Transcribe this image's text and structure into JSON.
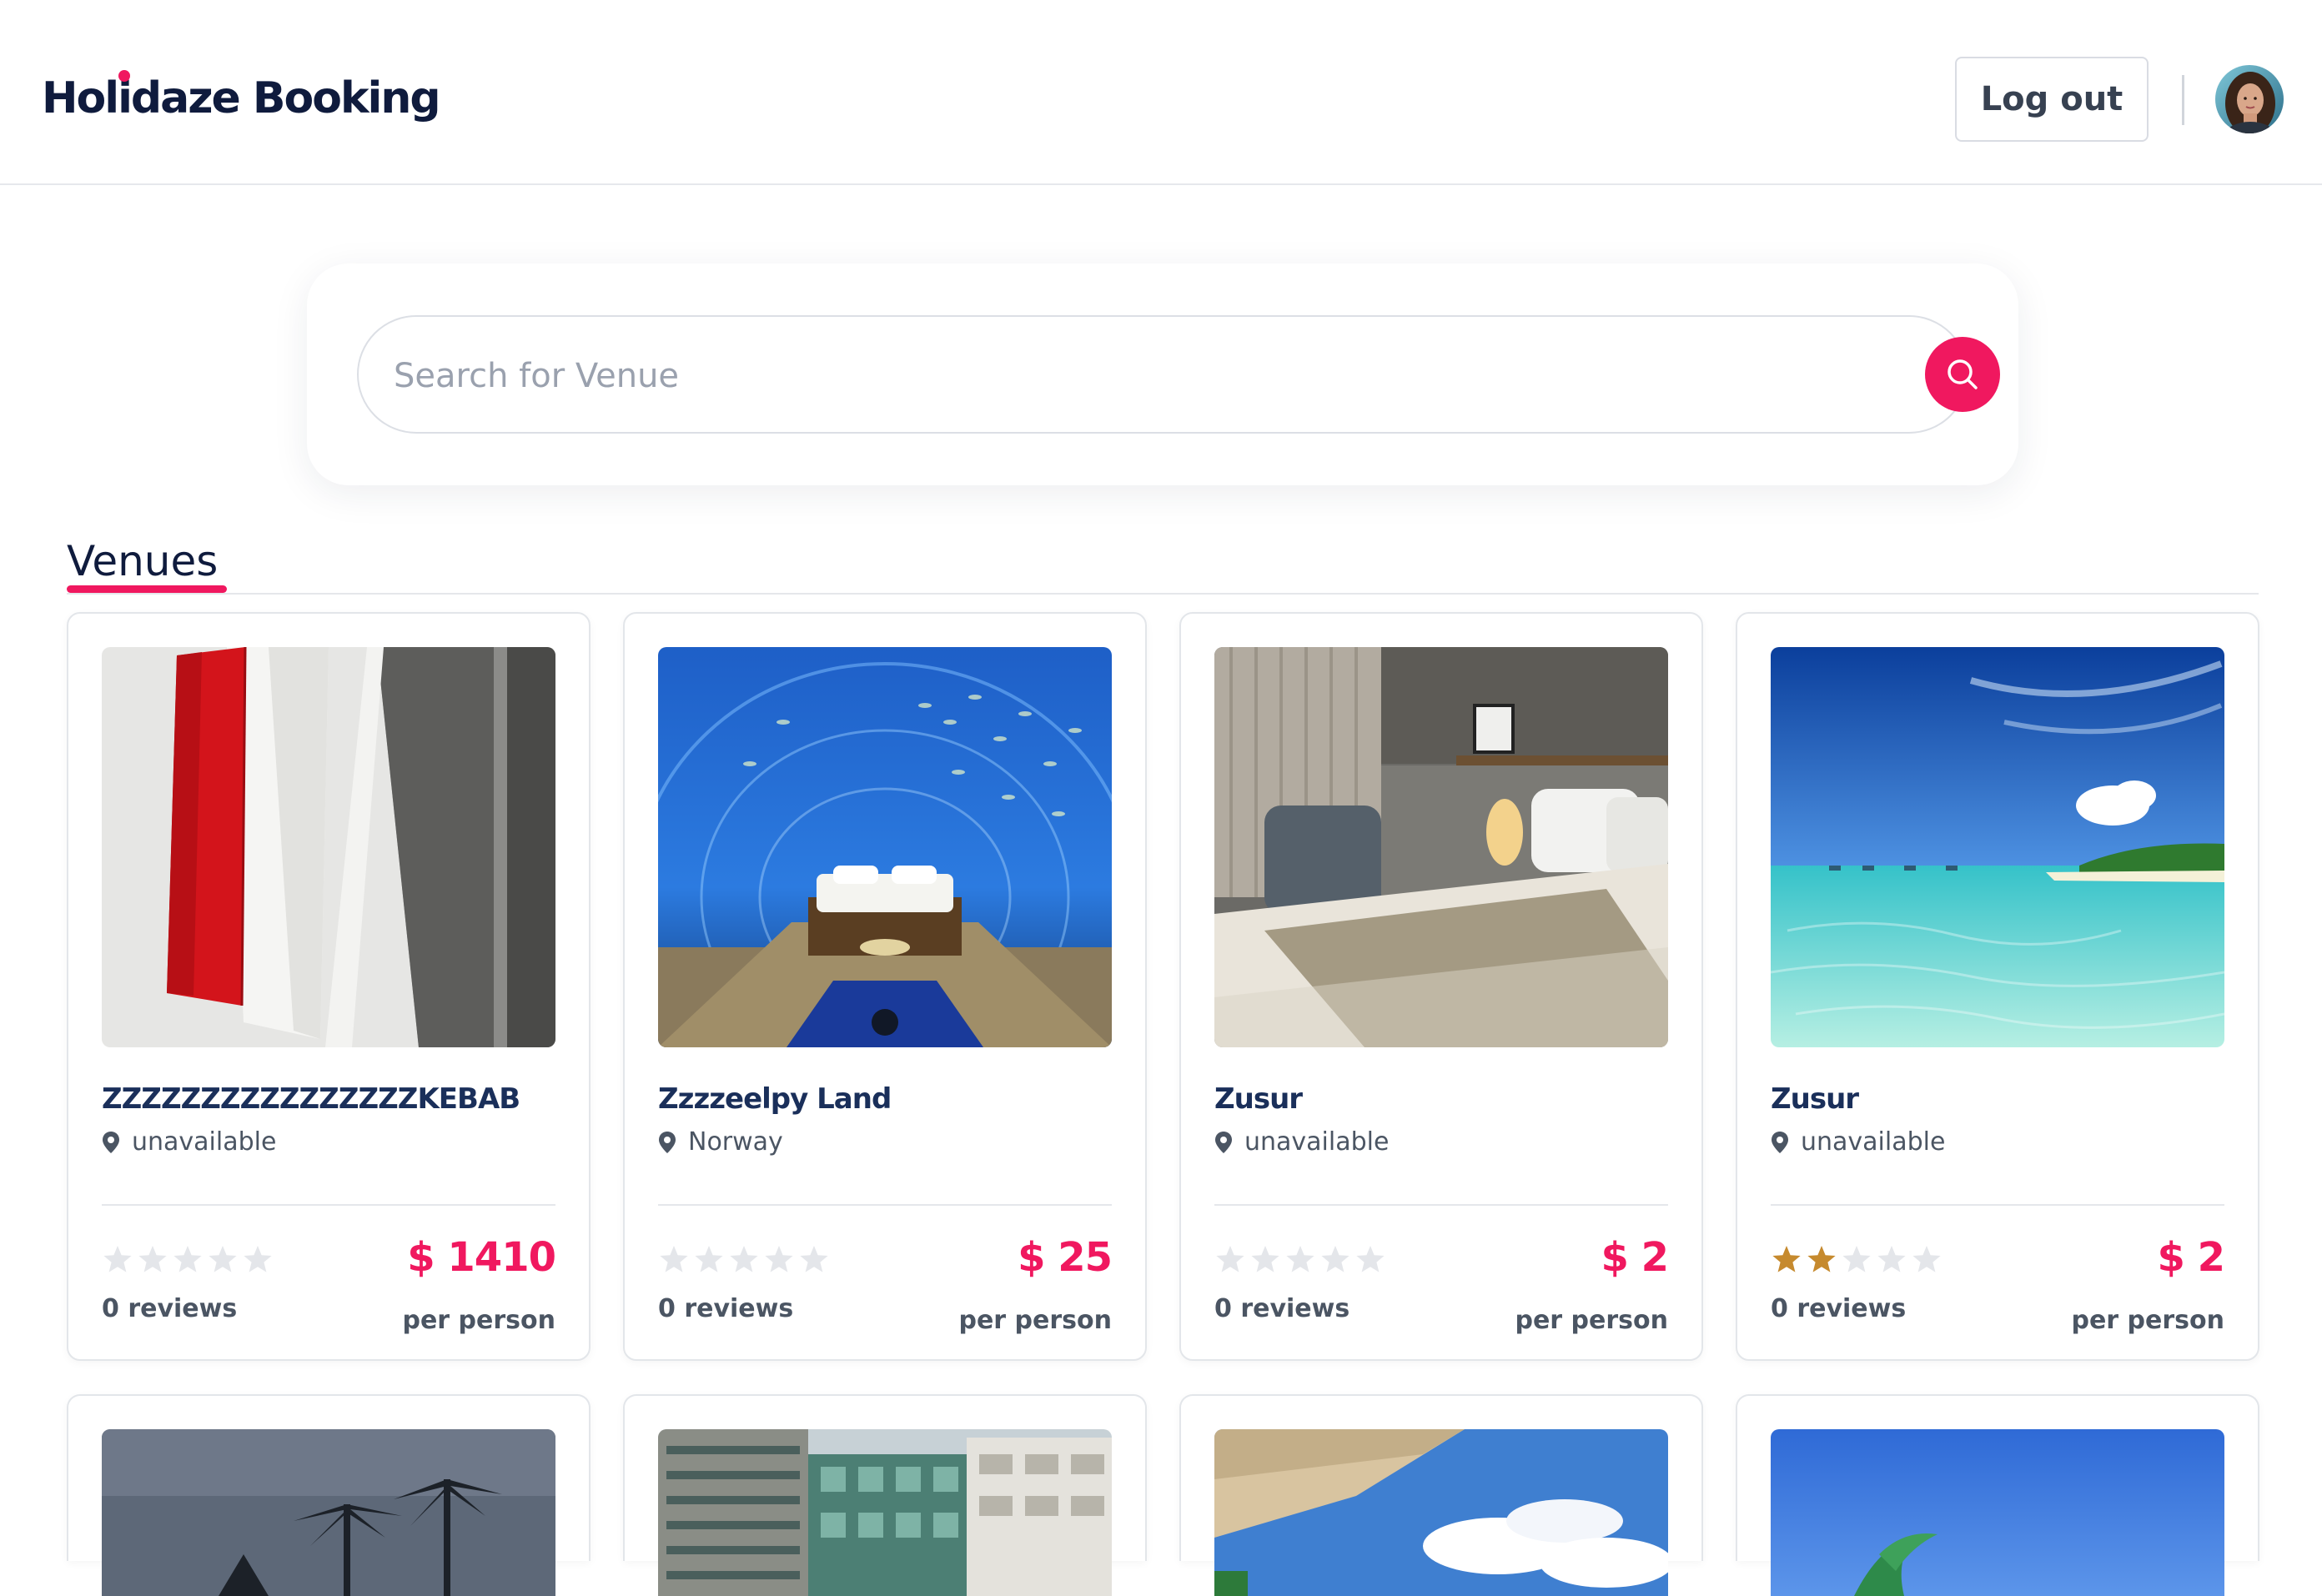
{
  "brand": {
    "name_parts": [
      "Hol",
      "i",
      "daze Booking"
    ],
    "accent": "#f0185f"
  },
  "header": {
    "logout_label": "Log out",
    "avatar_icon": "user-avatar"
  },
  "search": {
    "placeholder": "Search for Venue",
    "icon": "search-icon"
  },
  "section": {
    "title": "Venues"
  },
  "venues": [
    {
      "name": "ZZZZZZZZZZZZZZZZKEBAB",
      "location": "unavailable",
      "rating": 0,
      "reviews": "0 reviews",
      "price": "$ 1410",
      "price_unit": "per person"
    },
    {
      "name": "Zzzzeelpy Land",
      "location": "Norway",
      "rating": 0,
      "reviews": "0 reviews",
      "price": "$ 25",
      "price_unit": "per person"
    },
    {
      "name": "Zusur",
      "location": "unavailable",
      "rating": 0,
      "reviews": "0 reviews",
      "price": "$ 2",
      "price_unit": "per person"
    },
    {
      "name": "Zusur",
      "location": "unavailable",
      "rating": 2,
      "reviews": "0 reviews",
      "price": "$ 2",
      "price_unit": "per person"
    }
  ],
  "colors": {
    "star_filled": "#c68a2e",
    "star_empty": "#e4e6ea",
    "price": "#f0185f",
    "heading": "#0f1b3d"
  }
}
